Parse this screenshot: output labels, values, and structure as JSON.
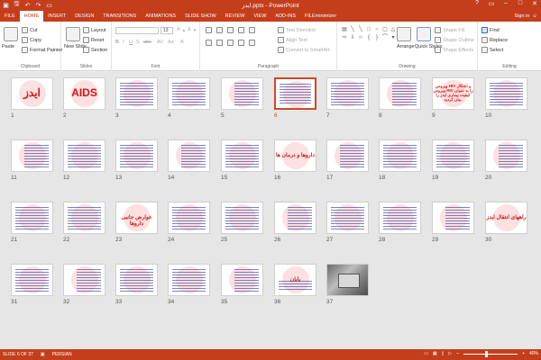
{
  "window": {
    "title": "ایدز.pptx - PowerPoint",
    "controls": [
      "?",
      "▭",
      "–",
      "□",
      "✕"
    ]
  },
  "qat": [
    "save-icon",
    "undo-icon",
    "redo-icon",
    "slideshow-icon"
  ],
  "tabs": [
    "FILE",
    "HOME",
    "INSERT",
    "DESIGN",
    "TRANSITIONS",
    "ANIMATIONS",
    "SLIDE SHOW",
    "REVIEW",
    "VIEW",
    "ADD-INS",
    "FILEminimizer"
  ],
  "active_tab": "HOME",
  "signin": "Sign in",
  "ribbon": {
    "clipboard": {
      "label": "Clipboard",
      "paste": "Paste",
      "cut": "Cut",
      "copy": "Copy",
      "format_painter": "Format Painter"
    },
    "slides": {
      "label": "Slides",
      "new_slide": "New Slide",
      "layout": "Layout",
      "reset": "Reset",
      "section": "Section"
    },
    "font": {
      "label": "Font",
      "size": "13"
    },
    "paragraph": {
      "label": "Paragraph",
      "text_direction": "Text Direction",
      "align_text": "Align Text",
      "smartart": "Convert to SmartArt"
    },
    "drawing": {
      "label": "Drawing",
      "arrange": "Arrange",
      "quick_styles": "Quick Styles",
      "shape_fill": "Shape Fill",
      "shape_outline": "Shape Outline",
      "shape_effects": "Shape Effects"
    },
    "editing": {
      "label": "Editing",
      "find": "Find",
      "replace": "Replace",
      "select": "Select"
    }
  },
  "slides": [
    {
      "n": "1",
      "kind": "title",
      "text": "ایدز"
    },
    {
      "n": "2",
      "kind": "title",
      "text": "AIDS"
    },
    {
      "n": "3",
      "kind": "text"
    },
    {
      "n": "4",
      "kind": "text"
    },
    {
      "n": "5",
      "kind": "text"
    },
    {
      "n": "6",
      "kind": "text",
      "selected": true
    },
    {
      "n": "7",
      "kind": "text"
    },
    {
      "n": "8",
      "kind": "text"
    },
    {
      "n": "9",
      "kind": "redtext",
      "text": "ویروس HIV و اشکال ویروس HIV را به عنوان کیفیت بیماری ایدز را بیان کردید."
    },
    {
      "n": "10",
      "kind": "text"
    },
    {
      "n": "11",
      "kind": "text"
    },
    {
      "n": "12",
      "kind": "text"
    },
    {
      "n": "13",
      "kind": "text"
    },
    {
      "n": "14",
      "kind": "text"
    },
    {
      "n": "15",
      "kind": "text"
    },
    {
      "n": "16",
      "kind": "heading",
      "text": "داروها و درمان ها"
    },
    {
      "n": "17",
      "kind": "text"
    },
    {
      "n": "18",
      "kind": "text"
    },
    {
      "n": "19",
      "kind": "text"
    },
    {
      "n": "20",
      "kind": "text"
    },
    {
      "n": "21",
      "kind": "text"
    },
    {
      "n": "22",
      "kind": "text"
    },
    {
      "n": "23",
      "kind": "heading",
      "text": "عوارض جانبی داروها"
    },
    {
      "n": "24",
      "kind": "text"
    },
    {
      "n": "25",
      "kind": "text"
    },
    {
      "n": "26",
      "kind": "text"
    },
    {
      "n": "27",
      "kind": "text"
    },
    {
      "n": "28",
      "kind": "text"
    },
    {
      "n": "29",
      "kind": "text"
    },
    {
      "n": "30",
      "kind": "heading",
      "text": "راههای انتقال ایدز"
    },
    {
      "n": "31",
      "kind": "text"
    },
    {
      "n": "32",
      "kind": "text"
    },
    {
      "n": "33",
      "kind": "text"
    },
    {
      "n": "34",
      "kind": "text"
    },
    {
      "n": "35",
      "kind": "text"
    },
    {
      "n": "36",
      "kind": "end",
      "text": "پایان"
    },
    {
      "n": "37",
      "kind": "photo"
    }
  ],
  "status": {
    "slide": "SLIDE 6 OF 37",
    "language": "PERSIAN",
    "zoom": "40%"
  }
}
